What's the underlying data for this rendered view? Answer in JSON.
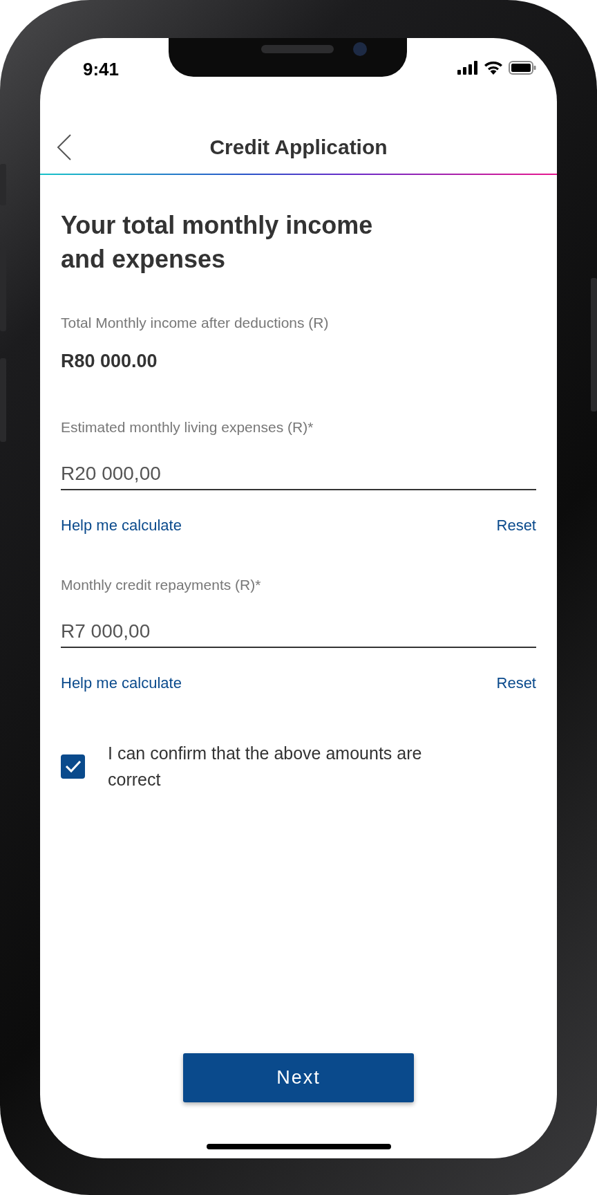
{
  "status_bar": {
    "time": "9:41"
  },
  "nav": {
    "title": "Credit Application"
  },
  "heading": "Your total monthly income and expenses",
  "income": {
    "label": "Total Monthly income after deductions (R)",
    "value": "R80 000.00"
  },
  "fields": [
    {
      "label": "Estimated monthly living expenses (R)*",
      "value": "R20 000,00",
      "help_link": "Help me calculate",
      "reset_link": "Reset"
    },
    {
      "label": "Monthly credit repayments (R)*",
      "value": "R7 000,00",
      "help_link": "Help me calculate",
      "reset_link": "Reset"
    }
  ],
  "confirm": {
    "label": "I can confirm that the above amounts are correct",
    "checked": true
  },
  "next_button": "Next"
}
